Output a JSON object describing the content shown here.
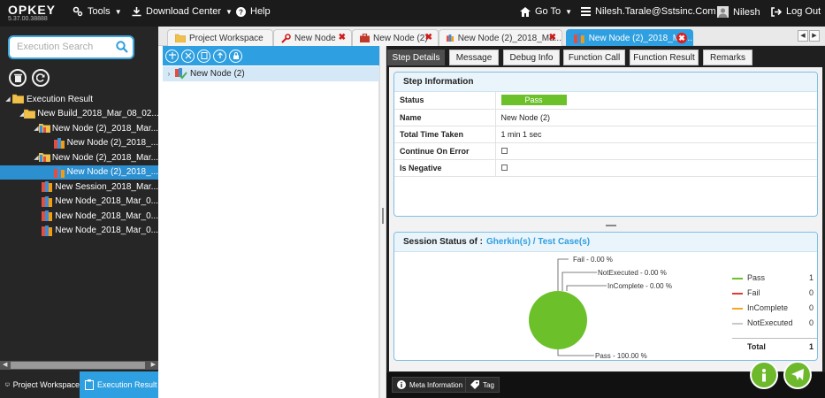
{
  "app": {
    "brand": "OPKEY",
    "version": "5.37.00.38888"
  },
  "topbar": {
    "tools": "Tools",
    "download_center": "Download Center",
    "help": "Help",
    "go_to": "Go To",
    "email": "Nilesh.Tarale@Sstsinc.Com",
    "user": "Nilesh",
    "logout": "Log Out"
  },
  "left_panel": {
    "search_placeholder": "Execution Search",
    "tree": [
      {
        "label": "Execution Result",
        "level": 0,
        "icon": "folder-icon"
      },
      {
        "label": "New Build_2018_Mar_08_02...",
        "level": 1,
        "icon": "folder-icon"
      },
      {
        "label": "New Node (2)_2018_Mar...",
        "level": 2,
        "icon": "suite-icon"
      },
      {
        "label": "New Node (2)_2018_...",
        "level": 3,
        "icon": "testcase-icon"
      },
      {
        "label": "New Node (2)_2018_Mar...",
        "level": 2,
        "icon": "suite-icon"
      },
      {
        "label": "New Node (2)_2018_...",
        "level": 3,
        "icon": "testcase-icon",
        "selected": true
      },
      {
        "label": "New Session_2018_Mar...",
        "level": 2,
        "icon": "session-icon"
      },
      {
        "label": "New Node_2018_Mar_0...",
        "level": 2,
        "icon": "session-icon"
      },
      {
        "label": "New Node_2018_Mar_0...",
        "level": 2,
        "icon": "session-icon"
      },
      {
        "label": "New Node_2018_Mar_0...",
        "level": 2,
        "icon": "session-icon"
      }
    ],
    "bottom_tabs": {
      "project_workspace": "Project Workspace",
      "execution_result": "Execution Result"
    }
  },
  "doc_tabs": [
    {
      "label": "Project Workspace",
      "icon": "folder-icon"
    },
    {
      "label": "New Node",
      "icon": "wrench-icon"
    },
    {
      "label": "New Node (2)",
      "icon": "briefcase-icon"
    },
    {
      "label": "New Node (2)_2018_Ma...",
      "icon": "testcase-icon"
    },
    {
      "label": "New Node (2)_2018_Ma...",
      "icon": "testcase-icon",
      "active": true
    }
  ],
  "middle": {
    "node_label": "New Node (2)"
  },
  "detail_tabs": [
    "Step Details",
    "Message",
    "Debug Info",
    "Function Call",
    "Function Result",
    "Remarks"
  ],
  "step_info": {
    "title": "Step Information",
    "rows": {
      "status_label": "Status",
      "status_value": "Pass",
      "name_label": "Name",
      "name_value": "New Node (2)",
      "time_label": "Total Time Taken",
      "time_value": "1 min 1 sec",
      "continue_label": "Continue On Error",
      "negative_label": "Is Negative"
    }
  },
  "session": {
    "title": "Session Status of :",
    "link": "Gherkin(s) / Test Case(s)",
    "annotations": {
      "fail": "Fail - 0.00 %",
      "notexecuted": "NotExecuted - 0.00 %",
      "incomplete": "InComplete - 0.00 %",
      "pass": "Pass - 100.00 %"
    },
    "legend": [
      {
        "name": "Pass",
        "value": "1",
        "color": "#6cc02a"
      },
      {
        "name": "Fail",
        "value": "0",
        "color": "#e03c31"
      },
      {
        "name": "InComplete",
        "value": "0",
        "color": "#f5a623"
      },
      {
        "name": "NotExecuted",
        "value": "0",
        "color": "#c8c8c8"
      }
    ],
    "total_label": "Total",
    "total_value": "1"
  },
  "chart_data": {
    "type": "pie",
    "categories": [
      "Pass",
      "Fail",
      "InComplete",
      "NotExecuted"
    ],
    "values": [
      100.0,
      0.0,
      0.0,
      0.0
    ],
    "counts": [
      1,
      0,
      0,
      0
    ],
    "title": "",
    "legend_position": "right"
  },
  "right_bottom": {
    "meta_information": "Meta Information",
    "tag": "Tag"
  }
}
